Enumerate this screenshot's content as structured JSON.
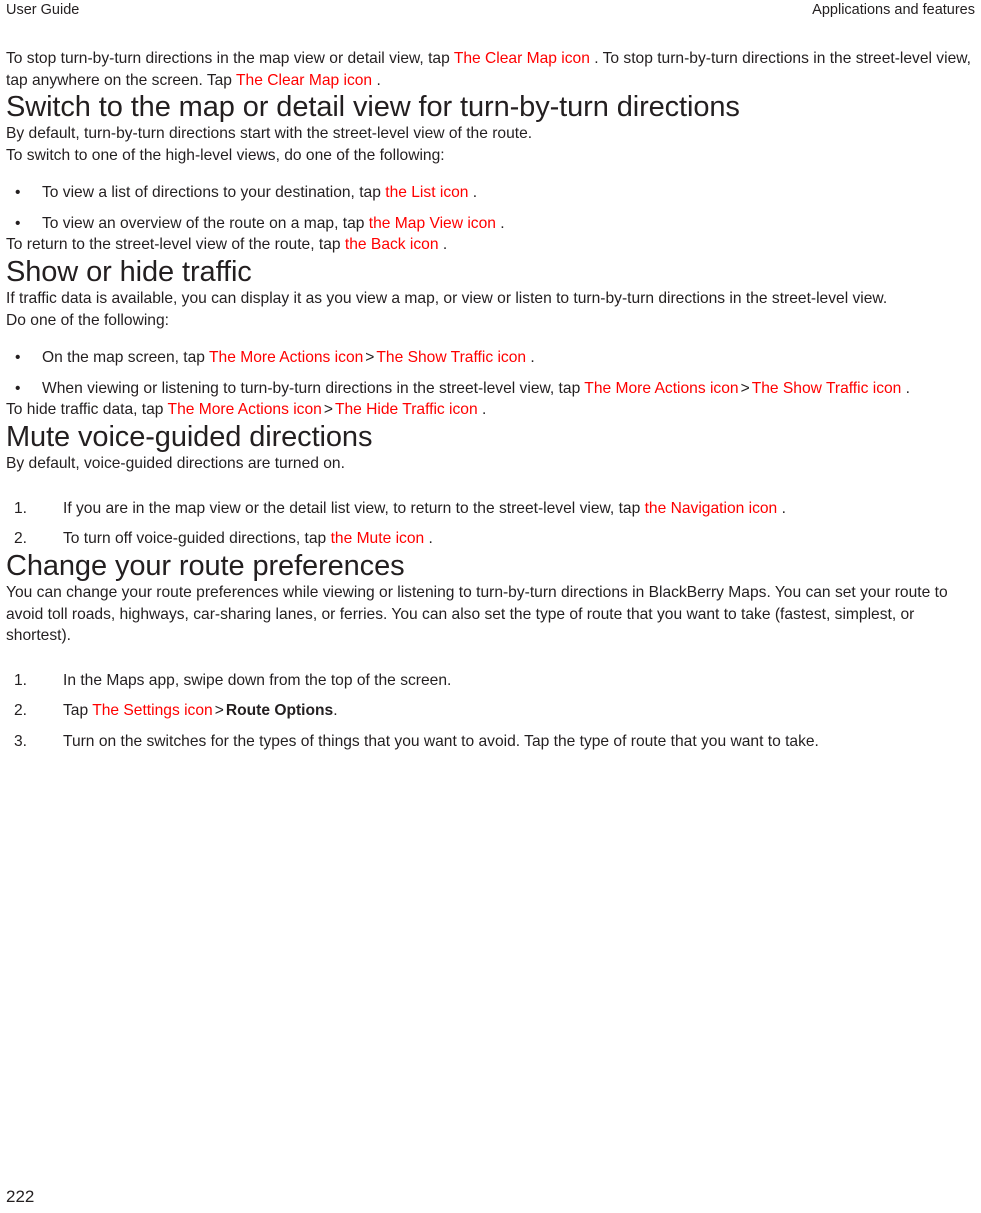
{
  "header": {
    "left": "User Guide",
    "right": "Applications and features"
  },
  "footer": {
    "page_number": "222"
  },
  "colors": {
    "icon_reference": "#ff0000",
    "body_text": "#231f20",
    "page_background": "#ffffff"
  },
  "intro": {
    "para_1_part_1": "To stop turn-by-turn directions in the map view or detail view, tap ",
    "para_1_icon_1": "The Clear Map icon",
    "para_1_part_2": " . To stop turn-by-turn directions in the street-level view, tap anywhere on the screen. Tap ",
    "para_1_icon_2": "The Clear Map icon",
    "para_1_part_3": " ."
  },
  "sections": [
    {
      "heading": "Switch to the map or detail view for turn-by-turn directions",
      "lead": "By default, turn-by-turn directions start with the street-level view of the route.",
      "intro_line": "To switch to one of the high-level views, do one of the following:",
      "bullets": [
        {
          "marker": "•",
          "text_before": "To view a list of directions to your destination, tap ",
          "icon": "the List icon",
          "text_after": " ."
        },
        {
          "marker": "•",
          "text_before": "To view an overview of the route on a map, tap ",
          "icon": "the Map View icon",
          "text_after": " ."
        }
      ],
      "closing_before": "To return to the street-level view of the route, tap ",
      "closing_icon": "the Back icon",
      "closing_after": " ."
    },
    {
      "heading": "Show or hide traffic",
      "lead": "If traffic data is available, you can display it as you view a map, or view or listen to turn-by-turn directions in the street-level view.",
      "intro_line": "Do one of the following:",
      "bullets": [
        {
          "marker": "•",
          "text_before": "On the map screen, tap ",
          "icon_1": "The More Actions icon",
          "separator": ">",
          "icon_2": "The Show Traffic icon",
          "text_after": " ."
        },
        {
          "marker": "•",
          "text_before": "When viewing or listening to turn-by-turn directions in the street-level view, tap ",
          "icon_1": "The More Actions icon",
          "separator": ">",
          "icon_2": "The Show Traffic icon",
          "text_after": " ."
        }
      ],
      "closing_before": "To hide traffic data, tap ",
      "closing_icon_1": "The More Actions icon",
      "closing_separator": ">",
      "closing_icon_2": "The Hide Traffic icon",
      "closing_after": " ."
    },
    {
      "heading": "Mute voice-guided directions",
      "lead": "By default, voice-guided directions are turned on.",
      "steps": [
        {
          "marker": "1.",
          "text_before": "If you are in the map view or the detail list view, to return to the street-level view, tap ",
          "icon": "the Navigation icon",
          "text_after": " ."
        },
        {
          "marker": "2.",
          "text_before": "To turn off voice-guided directions, tap ",
          "icon": "the Mute icon",
          "text_after": " ."
        }
      ]
    },
    {
      "heading": "Change your route preferences",
      "lead": "You can change your route preferences while viewing or listening to turn-by-turn directions in BlackBerry Maps. You can set your route to avoid toll roads, highways, car-sharing lanes, or ferries. You can also set the type of route that you want to take (fastest, simplest, or shortest).",
      "steps": [
        {
          "marker": "1.",
          "text": "In the Maps app, swipe down from the top of the screen."
        },
        {
          "marker": "2.",
          "text_before": "Tap ",
          "icon": "The Settings icon",
          "separator": ">",
          "bold_label": "Route Options",
          "text_after": "."
        },
        {
          "marker": "3.",
          "text": "Turn on the switches for the types of things that you want to avoid. Tap the type of route that you want to take."
        }
      ]
    }
  ]
}
